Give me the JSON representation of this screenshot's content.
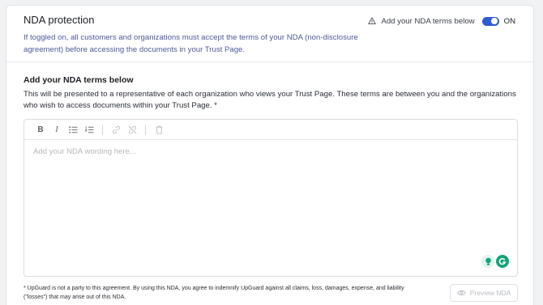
{
  "header": {
    "title": "NDA protection",
    "description": "If toggled on, all customers and organizations must accept the terms of your NDA (non-disclosure agreement) before accessing the documents in your Trust Page.",
    "warning_label": "Add your NDA terms below",
    "toggle_state": "ON",
    "toggle_on": true
  },
  "terms": {
    "title": "Add your NDA terms below",
    "text": "This will be presented to a representative of each organization who views your Trust Page. These terms are between you and the organizations who wish to access documents within your Trust Page. *"
  },
  "editor": {
    "toolbar": [
      "bold-icon",
      "italic-icon",
      "bullet-list-icon",
      "numbered-list-icon",
      "link-icon",
      "unlink-icon",
      "trash-icon"
    ],
    "placeholder": "Add your NDA wording here..."
  },
  "footer": {
    "footnote": "* UpGuard is not a party to this agreement. By using this NDA, you agree to indemnify UpGuard against all claims, loss, damages, expense, and liability (\"losses\") that may arise out of this NDA.",
    "preview_label": "Preview NDA"
  },
  "colors": {
    "accent": "#2f5bd4",
    "description": "#4f5a9a",
    "grammarly": "#15a37a"
  }
}
